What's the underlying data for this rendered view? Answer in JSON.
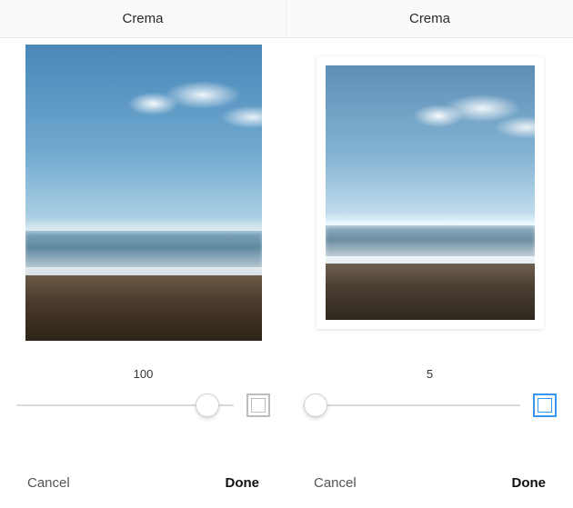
{
  "left": {
    "title": "Crema",
    "slider": {
      "value": "100",
      "position_pct": 88
    },
    "frame_toggle_active": false,
    "cancel_label": "Cancel",
    "done_label": "Done"
  },
  "right": {
    "title": "Crema",
    "slider": {
      "value": "5",
      "position_pct": 6
    },
    "frame_toggle_active": true,
    "cancel_label": "Cancel",
    "done_label": "Done"
  }
}
